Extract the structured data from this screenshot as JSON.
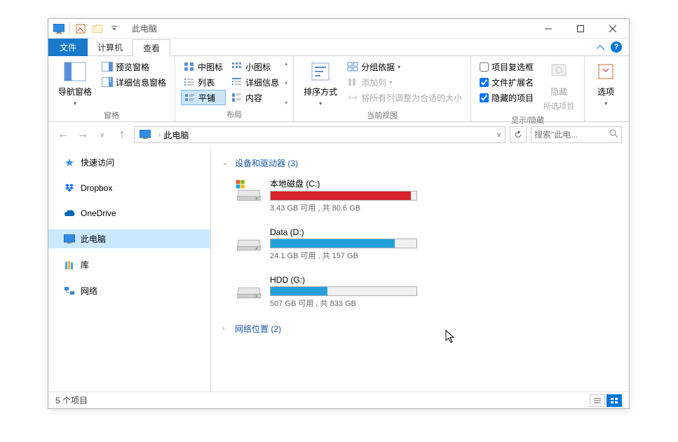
{
  "title": "此电脑",
  "tabs": {
    "file": "文件",
    "computer": "计算机",
    "view": "查看"
  },
  "ribbon": {
    "panes": {
      "nav_pane": "导航窗格",
      "preview_pane": "预览窗格",
      "details_pane": "详细信息窗格",
      "group_label": "窗格"
    },
    "layout": {
      "medium_icons": "中图标",
      "small_icons": "小图标",
      "list": "列表",
      "details": "详细信息",
      "tiles": "平铺",
      "content": "内容",
      "group_label": "布局"
    },
    "current_view": {
      "sort": "排序方式",
      "group_by": "分组依据",
      "add_columns": "添加列",
      "size_columns": "将所有列调整为合适的大小",
      "group_label": "当前视图"
    },
    "show_hide": {
      "item_checkboxes": "项目复选框",
      "file_ext": "文件扩展名",
      "hidden_items": "隐藏的项目",
      "hide": "隐藏",
      "hide_selected": "所选项目",
      "group_label": "显示/隐藏"
    },
    "options": "选项"
  },
  "address": {
    "location": "此电脑"
  },
  "search": {
    "placeholder": "搜索\"此电..."
  },
  "sidebar": {
    "quick_access": "快速访问",
    "dropbox": "Dropbox",
    "onedrive": "OneDrive",
    "this_pc": "此电脑",
    "libraries": "库",
    "network": "网络"
  },
  "content": {
    "devices_header": "设备和驱动器 (3)",
    "network_header": "网络位置 (2)",
    "drives": [
      {
        "name": "本地磁盘 (C:)",
        "status": "3.43 GB 可用 , 共 80.6 GB",
        "fill_pct": 96,
        "color": "#d9232d",
        "type": "system"
      },
      {
        "name": "Data (D:)",
        "status": "24.1 GB 可用 , 共 157 GB",
        "fill_pct": 85,
        "color": "#249fda",
        "type": "hdd"
      },
      {
        "name": "HDD (G:)",
        "status": "507 GB 可用 , 共 833 GB",
        "fill_pct": 39,
        "color": "#249fda",
        "type": "hdd"
      }
    ]
  },
  "statusbar": {
    "items": "5 个项目"
  }
}
